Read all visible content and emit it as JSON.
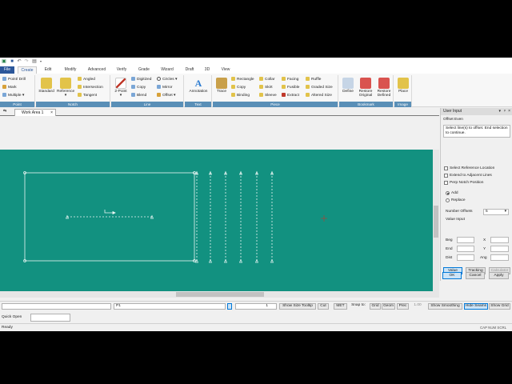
{
  "qat": {
    "icons": [
      "app-icon",
      "save-icon",
      "undo-icon",
      "redo-icon",
      "print-icon",
      "customize-dropdown-icon"
    ]
  },
  "tabs": [
    "File",
    "Create",
    "Edit",
    "Modify",
    "Advanced",
    "Verify",
    "Grade",
    "Wizard",
    "Draft",
    "3D",
    "View"
  ],
  "active_tab": "Create",
  "ribbon": {
    "point": {
      "label": "Point",
      "items": [
        "Point/ Drill",
        "Mark",
        "Multiple"
      ]
    },
    "notch": {
      "label": "Notch",
      "standard": "Standard",
      "reference": "Reference",
      "items": [
        "Angled",
        "Intersection",
        "Tangent"
      ]
    },
    "line": {
      "label": "Line",
      "two_point": "2-Point",
      "items": [
        "Digitized",
        "Copy",
        "Blend",
        "Circles",
        "Mirror",
        "Offset"
      ]
    },
    "text": {
      "label": "Text",
      "annotation": "Annotation"
    },
    "piece": {
      "label": "Piece",
      "trace": "Trace",
      "items": [
        "Rectangle",
        "Copy",
        "Binding",
        "Collar",
        "Skirt",
        "Sleeve",
        "Facing",
        "Fusible",
        "Extract",
        "Ruffle",
        "Graded Size",
        "Altered Size"
      ]
    },
    "bookmark": {
      "label": "Bookmark",
      "define": "Define",
      "restore_original_1": "Restore",
      "restore_original_2": "Original",
      "restore_defined_1": "Restore",
      "restore_defined_2": "Defined"
    },
    "image": {
      "label": "Image",
      "place": "Place"
    }
  },
  "doc_tab": {
    "label": "Work Area 1",
    "close": "×"
  },
  "user_input": {
    "title": "User Input",
    "pin": "▾",
    "pin2": "ᵖ",
    "close": "×",
    "function": "Offset Even",
    "prompt": "Select line(s) to offset. End selection to continue.",
    "options": [
      "Select Reference Location",
      "Extend to Adjacent Lines",
      "Perp Notch Position"
    ],
    "radios": [
      "Add",
      "Replace"
    ],
    "number_offsets_label": "Number Offsets",
    "number_offsets_value": "5",
    "value_input_label": "Value Input",
    "beg": "Beg",
    "x": "X",
    "end": "End",
    "y": "Y",
    "dist": "Dist",
    "ang": "Ang",
    "buttons": {
      "value": "Value",
      "tracking": "Tracking",
      "calculator": "Calculator",
      "ok": "OK",
      "cancel": "Cancel",
      "apply": "Apply"
    }
  },
  "statusbar": {
    "piece": "P1",
    "number": "1",
    "show_size_tooltip": "Show Size Tooltip",
    "cut": "Cut",
    "units": "MET",
    "snap_to": "Snap to:",
    "grid": "Grid",
    "geom": "Geom",
    "prec": "Prec",
    "precision": "1.00",
    "show_smoothing": "Show Smoothing",
    "hide_seams": "Hide Seams",
    "show_grid": "Show Grid"
  },
  "quick_open_label": "Quick Open",
  "ready": "Ready",
  "indicators": "CAP  NUM  SCRL",
  "colors": {
    "canvas": "#129180",
    "file_tab": "#2b579a",
    "group_label": "#5a8fb7"
  }
}
